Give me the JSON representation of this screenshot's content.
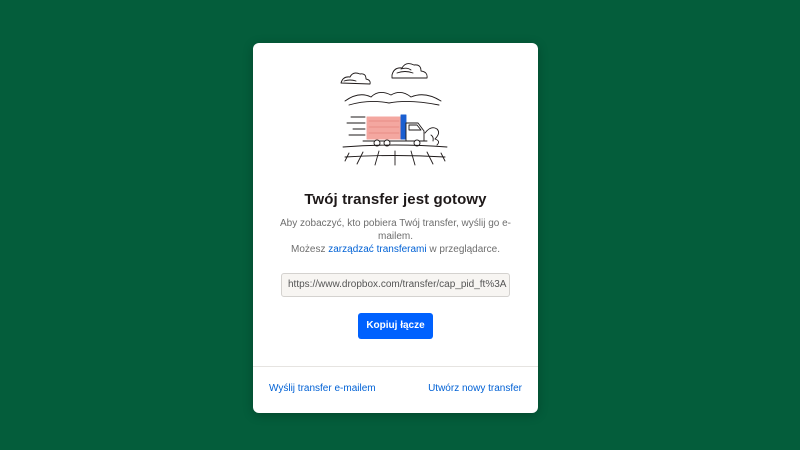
{
  "dialog": {
    "title": "Twój transfer jest gotowy",
    "description_line1": "Aby zobaczyć, kto pobiera Twój transfer, wyślij go e-mailem.",
    "description_prefix": "Możesz ",
    "manage_link": "zarządzać transferami",
    "description_suffix": " w przeglądarce.",
    "url_value": "https://www.dropbox.com/transfer/cap_pid_ft%3A",
    "copy_button": "Kopiuj łącze",
    "footer_left_link": "Wyślij transfer e-mailem",
    "footer_right_link": "Utwórz nowy transfer"
  },
  "illustration": {
    "icon": "delivery-truck-illustration"
  },
  "colors": {
    "background": "#045d3b",
    "card": "#ffffff",
    "primary": "#0061fe",
    "link": "#0061d5",
    "truck_accent": "#f4a7a0",
    "truck_blue": "#1a5fd1"
  }
}
